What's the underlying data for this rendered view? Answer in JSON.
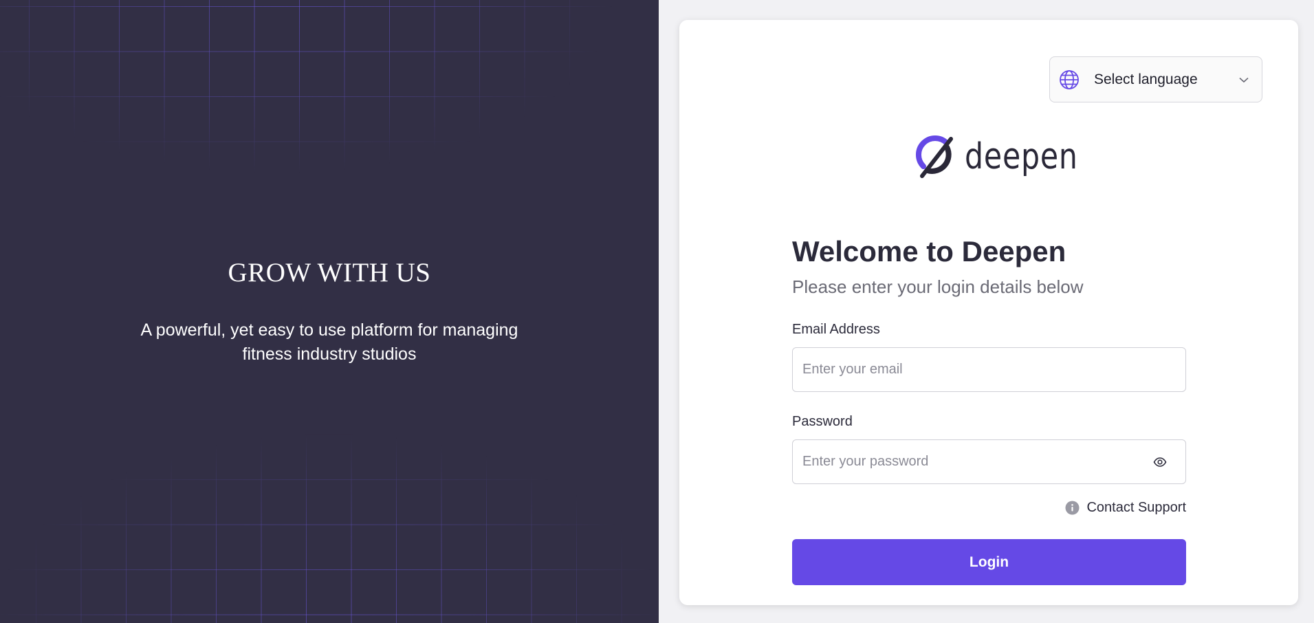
{
  "hero": {
    "title": "GROW WITH US",
    "subtitle": "A powerful, yet easy to use platform for managing fitness industry studios"
  },
  "language": {
    "label": "Select language",
    "icon": "globe-icon"
  },
  "brand": {
    "name": "deepen"
  },
  "login": {
    "title": "Welcome to Deepen",
    "subtitle": "Please enter your login details below",
    "email_label": "Email Address",
    "email_placeholder": "Enter your email",
    "email_value": "",
    "password_label": "Password",
    "password_placeholder": "Enter your password",
    "password_value": "",
    "support_label": "Contact Support",
    "submit_label": "Login"
  },
  "colors": {
    "panel_bg": "#322f45",
    "accent": "#6549e6",
    "grid_line": "#6e5ae6"
  }
}
